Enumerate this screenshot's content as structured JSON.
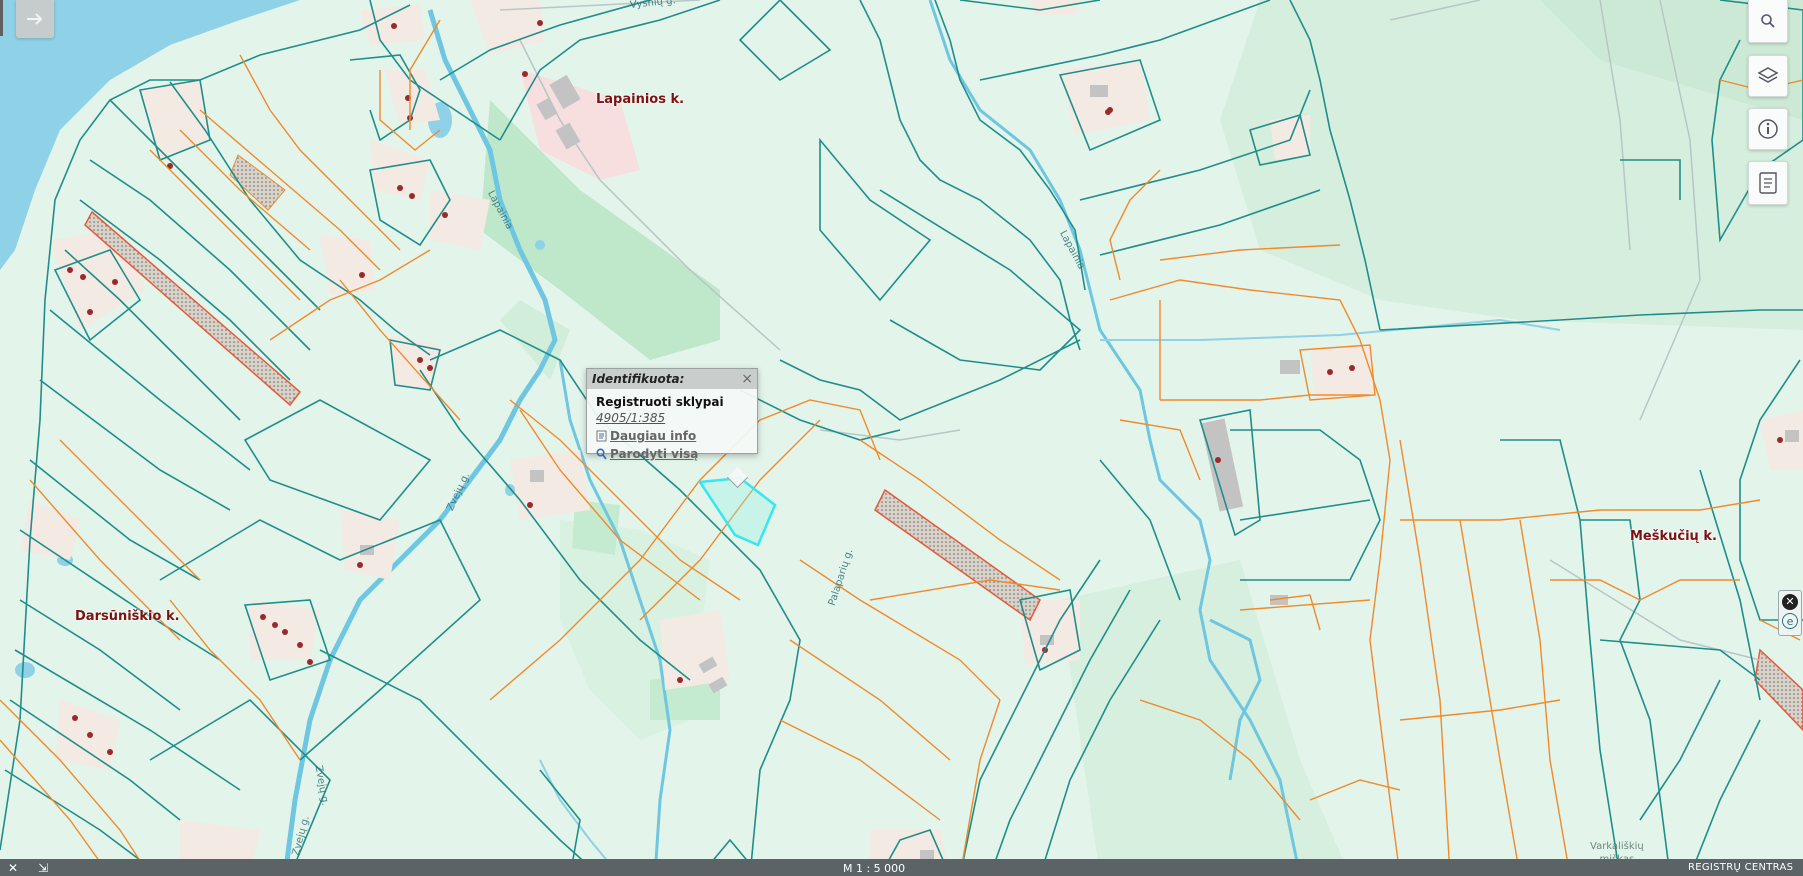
{
  "map": {
    "places": [
      "Lapainios k.",
      "Darsūniškio k.",
      "Meškučių k."
    ],
    "streets": [
      "Vyšnių g.",
      "Rožių g.",
      "Zvejų g.",
      "Zvejų g.",
      "Zvejų g.",
      "Palaparių g.",
      "Lapainia"
    ],
    "forest_label_1": "Varkališkių",
    "forest_label_2": "miškas"
  },
  "popup": {
    "title": "Identifikuota:",
    "close": "×",
    "layer": "Registruoti sklypai",
    "parcel_id": "4905/1:385",
    "more_info": "Daugiau info",
    "show_all": "Parodyti visą"
  },
  "toolbar": {
    "search_icon": "search-icon",
    "layers_icon": "layers-icon",
    "info_icon": "info-icon",
    "legend_icon": "legend-icon",
    "arrow_icon": "arrow-right-icon"
  },
  "side_mini": {
    "close_glyph": "✕",
    "e_glyph": "e"
  },
  "statusbar": {
    "scale": "M 1 : 5 000",
    "register": "REGISTRŲ CENTRAS",
    "left_glyph_1": "✕",
    "left_glyph_2": "⇲"
  },
  "colors": {
    "background": "#e3f4ea",
    "water": "#8fd1e6",
    "cadastre_line": "#1f8e8a",
    "orange_line": "#ef8b2c",
    "highlight": "#36e6f0",
    "building": "#c7c7c7",
    "label": "#7a1414"
  }
}
